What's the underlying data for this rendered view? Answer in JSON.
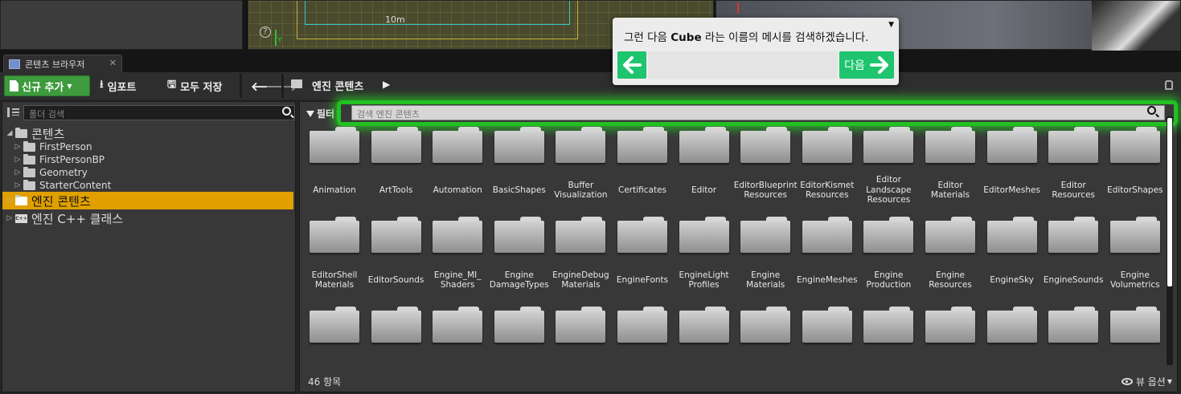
{
  "viewport": {
    "scale_label": "10m",
    "help_label": "?",
    "axis_label": "Y"
  },
  "tab": {
    "title": "콘텐츠 브라우저",
    "close": "✕"
  },
  "toolbar": {
    "add_new_label": "신규 추가",
    "import_label": "임포트",
    "save_all_label": "모두 저장",
    "path_label": "엔진 콘텐츠"
  },
  "tree": {
    "search_placeholder": "폴더 검색",
    "items": [
      {
        "label": "콘텐츠",
        "expander": "◢",
        "size": "big",
        "indent": 0
      },
      {
        "label": "FirstPerson",
        "expander": "▷",
        "size": "small",
        "indent": 1
      },
      {
        "label": "FirstPersonBP",
        "expander": "▷",
        "size": "small",
        "indent": 1
      },
      {
        "label": "Geometry",
        "expander": "▷",
        "size": "small",
        "indent": 1
      },
      {
        "label": "StarterContent",
        "expander": "▷",
        "size": "small",
        "indent": 1
      },
      {
        "label": "엔진 콘텐츠",
        "expander": "▷",
        "size": "big",
        "indent": 0,
        "selected": true
      },
      {
        "label": "엔진 C++ 클래스",
        "expander": "▷",
        "size": "big",
        "indent": 0,
        "cpp": true
      }
    ]
  },
  "content": {
    "filter_label": "필터",
    "search_placeholder": "검색 엔진 콘텐츠",
    "folders": [
      "Animation",
      "ArtTools",
      "Automation",
      "BasicShapes",
      "Buffer\nVisualization",
      "Certificates",
      "Editor",
      "EditorBlueprint\nResources",
      "EditorKismet\nResources",
      "Editor\nLandscape\nResources",
      "Editor\nMaterials",
      "EditorMeshes",
      "Editor\nResources",
      "EditorShapes",
      "EditorShell\nMaterials",
      "EditorSounds",
      "Engine_MI_\nShaders",
      "Engine\nDamageTypes",
      "EngineDebug\nMaterials",
      "EngineFonts",
      "EngineLight\nProfiles",
      "Engine\nMaterials",
      "EngineMeshes",
      "Engine\nProduction",
      "Engine\nResources",
      "EngineSky",
      "EngineSounds",
      "Engine\nVolumetrics",
      "",
      "",
      "",
      "",
      "",
      "",
      "",
      "",
      "",
      "",
      "",
      "",
      "",
      ""
    ],
    "item_count": "46 항목",
    "view_options_label": "뷰 옵션"
  },
  "tutorial": {
    "text_before": "그런 다음 ",
    "text_bold": "Cube",
    "text_after": " 라는 이름의 메시를 검색하겠습니다.",
    "next_label": "다음",
    "menu": "▼",
    "back_arrow": "←",
    "next_arrow": "→"
  },
  "colors": {
    "selected_folder": "#e0a000",
    "add_new_button": "#3d9a3d",
    "highlight_glow": "#22c022",
    "tutorial_button": "#1ec46e"
  }
}
